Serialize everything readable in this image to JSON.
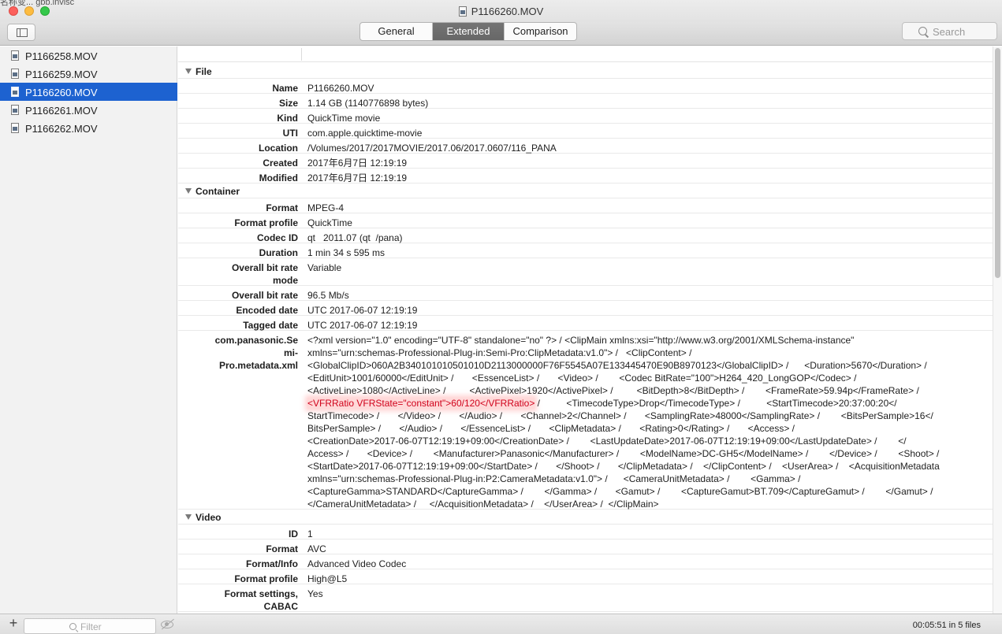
{
  "background_app_text": "名称变... gbb.invisc",
  "window": {
    "title": "P1166260.MOV"
  },
  "toolbar": {
    "tabs": [
      {
        "label": "General",
        "active": false
      },
      {
        "label": "Extended",
        "active": true
      },
      {
        "label": "Comparison",
        "active": false
      }
    ],
    "search_placeholder": "Search"
  },
  "sidebar": {
    "files": [
      {
        "label": "P1166258.MOV",
        "selected": false
      },
      {
        "label": "P1166259.MOV",
        "selected": false
      },
      {
        "label": "P1166260.MOV",
        "selected": true
      },
      {
        "label": "P1166261.MOV",
        "selected": false
      },
      {
        "label": "P1166262.MOV",
        "selected": false
      }
    ],
    "filter_placeholder": "Filter"
  },
  "status": {
    "text": "00:05:51 in 5 files"
  },
  "details": {
    "file": {
      "label": "File",
      "rows": [
        {
          "key": "Name",
          "value": "P1166260.MOV"
        },
        {
          "key": "Size",
          "value": "1.14 GB (1140776898 bytes)"
        },
        {
          "key": "Kind",
          "value": "QuickTime movie"
        },
        {
          "key": "UTI",
          "value": "com.apple.quicktime-movie"
        },
        {
          "key": "Location",
          "value": "/Volumes/2017/2017MOVIE/2017.06/2017.0607/116_PANA"
        },
        {
          "key": "Created",
          "value": "2017年6月7日 12:19:19"
        },
        {
          "key": "Modified",
          "value": "2017年6月7日 12:19:19"
        }
      ]
    },
    "container": {
      "label": "Container",
      "rows": [
        {
          "key": "Format",
          "value": "MPEG-4"
        },
        {
          "key": "Format profile",
          "value": "QuickTime"
        },
        {
          "key": "Codec ID",
          "value": "qt   2011.07 (qt  /pana)"
        },
        {
          "key": "Duration",
          "value": "1 min 34 s 595 ms"
        },
        {
          "key": "Overall bit rate\nmode",
          "value": "Variable"
        },
        {
          "key": "Overall bit rate",
          "value": "96.5 Mb/s"
        },
        {
          "key": "Encoded date",
          "value": "UTC 2017-06-07 12:19:19"
        },
        {
          "key": "Tagged date",
          "value": "UTC 2017-06-07 12:19:19"
        }
      ],
      "metadata_key": "com.panasonic.Se\nmi-\nPro.metadata.xml",
      "metadata_lines": [
        "<?xml version=\"1.0\" encoding=\"UTF-8\" standalone=\"no\" ?> / <ClipMain xmlns:xsi=\"http://www.w3.org/2001/XMLSchema-instance\"",
        "xmlns=\"urn:schemas-Professional-Plug-in:Semi-Pro:ClipMetadata:v1.0\"> /   <ClipContent> /",
        "<GlobalClipID>060A2B340101010501010D2113000000F76F5545A07E133445470E90B8970123</GlobalClipID> /      <Duration>5670</Duration> /",
        "<EditUnit>1001/60000</EditUnit> /       <EssenceList> /       <Video> /        <Codec BitRate=\"100\">H264_420_LongGOP</Codec> /",
        "<ActiveLine>1080</ActiveLine> /         <ActivePixel>1920</ActivePixel> /         <BitDepth>8</BitDepth> /        <FrameRate>59.94p</FrameRate> /",
        "",
        "StartTimecode> /       </Video> /       </Audio> /       <Channel>2</Channel> /       <SamplingRate>48000</SamplingRate> /        <BitsPerSample>16</",
        "BitsPerSample> /       </Audio> /       </EssenceList> /       <ClipMetadata> /       <Rating>0</Rating> /       <Access> /",
        "<CreationDate>2017-06-07T12:19:19+09:00</CreationDate> /        <LastUpdateDate>2017-06-07T12:19:19+09:00</LastUpdateDate> /        </",
        "Access> /       <Device> /        <Manufacturer>Panasonic</Manufacturer> /        <ModelName>DC-GH5</ModelName> /        </Device> /        <Shoot> /",
        "<StartDate>2017-06-07T12:19:19+09:00</StartDate> /       </Shoot> /       </ClipMetadata> /    </ClipContent> /    <UserArea> /    <AcquisitionMetadata",
        "xmlns=\"urn:schemas-Professional-Plug-in:P2:CameraMetadata:v1.0\"> /      <CameraUnitMetadata> /        <Gamma> /",
        "<CaptureGamma>STANDARD</CaptureGamma> /        </Gamma> /       <Gamut> /        <CaptureGamut>BT.709</CaptureGamut> /        </Gamut> /",
        "</CameraUnitMetadata> /     </AcquisitionMetadata> /    </UserArea> /  </ClipMain>"
      ],
      "metadata_highlight": "<VFRRatio VFRState=\"constant\">60/120</VFRRatio>",
      "metadata_highlight_tail": " /          <TimecodeType>Drop</TimecodeType> /          <StartTimecode>20:37:00:20</"
    },
    "video": {
      "label": "Video",
      "rows": [
        {
          "key": "ID",
          "value": "1"
        },
        {
          "key": "Format",
          "value": "AVC"
        },
        {
          "key": "Format/Info",
          "value": "Advanced Video Codec"
        },
        {
          "key": "Format profile",
          "value": "High@L5"
        },
        {
          "key": "Format settings,\nCABAC",
          "value": "Yes"
        }
      ]
    }
  },
  "colors": {
    "selection": "#1d62d0",
    "highlight": "#d0021b",
    "active_tab": "#6e6e6e"
  }
}
